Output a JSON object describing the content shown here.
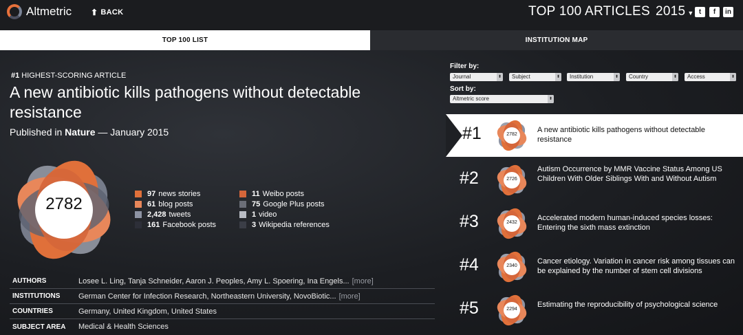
{
  "header": {
    "logo_text": "Altmetric",
    "back_label": "BACK",
    "title_main": "TOP 100 ARTICLES",
    "title_year": "2015"
  },
  "tabs": [
    {
      "label": "TOP 100 LIST",
      "active": true
    },
    {
      "label": "INSTITUTION MAP",
      "active": false
    }
  ],
  "article": {
    "rank_prefix": "#1",
    "rank_suffix": " HIGHEST-SCORING ARTICLE",
    "title": "A new antibiotic kills pathogens without detectable resistance",
    "published_prefix": "Published in ",
    "journal": "Nature",
    "published_suffix": " — January 2015",
    "score": "2782",
    "stats": [
      {
        "num": "97",
        "label": "news stories",
        "color": "#e0703a"
      },
      {
        "num": "61",
        "label": "blog posts",
        "color": "#e8875a"
      },
      {
        "num": "2,428",
        "label": "tweets",
        "color": "#8d93a3"
      },
      {
        "num": "161",
        "label": "Facebook posts",
        "color": "#2d2f38"
      },
      {
        "num": "11",
        "label": "Weibo posts",
        "color": "#d5663a"
      },
      {
        "num": "75",
        "label": "Google Plus posts",
        "color": "#6b6e78"
      },
      {
        "num": "1",
        "label": "video",
        "color": "#b9bcc4"
      },
      {
        "num": "3",
        "label": "Wikipedia references",
        "color": "#3b3e47"
      }
    ],
    "details": [
      {
        "key": "AUTHORS",
        "value": "Losee L. Ling, Tanja Schneider, Aaron J. Peoples, Amy L. Spoering, Ina Engels...",
        "more": "[more]"
      },
      {
        "key": "INSTITUTIONS",
        "value": "German Center for Infection Research, Northeastern University, NovoBiotic...",
        "more": "[more]"
      },
      {
        "key": "COUNTRIES",
        "value": "Germany, United Kingdom, United States",
        "more": ""
      },
      {
        "key": "SUBJECT AREA",
        "value": "Medical & Health Sciences",
        "more": ""
      }
    ]
  },
  "filters": {
    "filter_label": "Filter by:",
    "sort_label": "Sort by:",
    "options": [
      "Journal",
      "Subject",
      "Institution",
      "Country",
      "Access"
    ],
    "sort_value": "Altmetric score"
  },
  "list": [
    {
      "rank": "#1",
      "score": "2782",
      "title": "A new antibiotic kills pathogens without detectable resistance"
    },
    {
      "rank": "#2",
      "score": "2726",
      "title": "Autism Occurrence by MMR Vaccine Status Among US Children With Older Siblings With and Without Autism"
    },
    {
      "rank": "#3",
      "score": "2432",
      "title": "Accelerated modern human-induced species losses: Entering the sixth mass extinction"
    },
    {
      "rank": "#4",
      "score": "2340",
      "title": "Cancer etiology. Variation in cancer risk among tissues can be explained by the number of stem cell divisions"
    },
    {
      "rank": "#5",
      "score": "2294",
      "title": "Estimating the reproducibility of psychological science"
    }
  ],
  "colors": {
    "accent_orange": "#e0703a",
    "gray_blue": "#8d93a3",
    "dark_bg": "#1c1e22"
  }
}
